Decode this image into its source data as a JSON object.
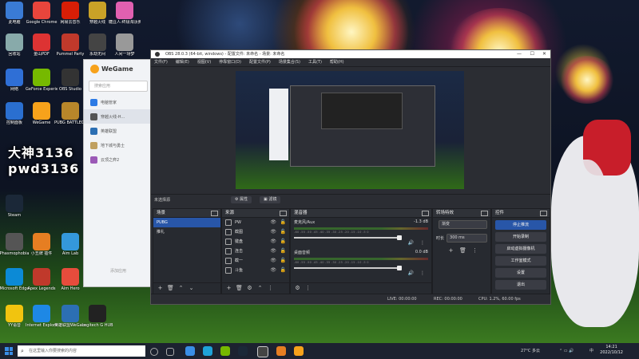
{
  "desktop": {
    "icons": [
      {
        "label": "此电脑",
        "color": "#3a7bd5"
      },
      {
        "label": "Google Chrome",
        "color": "#e8453c"
      },
      {
        "label": "网易云音乐",
        "color": "#d81e06"
      },
      {
        "label": "穿越火线",
        "color": "#c9a227"
      },
      {
        "label": "糖豆人:终极淘汰赛",
        "color": "#e060b0"
      },
      {
        "label": "回收站",
        "color": "#8aa"
      },
      {
        "label": "金山PDF",
        "color": "#d33"
      },
      {
        "label": "Pummel Party",
        "color": "#c0392b"
      },
      {
        "label": "永劫无间",
        "color": "#444"
      },
      {
        "label": "人间一场梦",
        "color": "#999"
      },
      {
        "label": "网络",
        "color": "#2f6fd6"
      },
      {
        "label": "GeForce Experience",
        "color": "#76b900"
      },
      {
        "label": "OBS Studio",
        "color": "#333"
      },
      {
        "label": "控制面板",
        "color": "#2a6fd0"
      },
      {
        "label": "WeGame",
        "color": "#f7a21b"
      },
      {
        "label": "PUBG BATTLEGR...",
        "color": "#b8862a"
      },
      {
        "label": "Steam",
        "color": "#1b2838"
      },
      {
        "label": "Phasmophobia",
        "color": "#555"
      },
      {
        "label": "小丑牌 插件",
        "color": "#e67e22"
      },
      {
        "label": "Aim Lab",
        "color": "#3498db"
      },
      {
        "label": "Microsoft Edge",
        "color": "#0c8ad6"
      },
      {
        "label": "Apex Legends",
        "color": "#c0392b"
      },
      {
        "label": "Aim Hero",
        "color": "#e74c3c"
      },
      {
        "label": "YY语音",
        "color": "#f1c40f"
      },
      {
        "label": "Internet Explorer",
        "color": "#1e88e5"
      },
      {
        "label": "英雄联盟WeGame版",
        "color": "#2c6fb3"
      },
      {
        "label": "Logitech G HUB",
        "color": "#222"
      }
    ],
    "overlay_line1": "大神3136",
    "overlay_line2": "pwd3136"
  },
  "wegame": {
    "brand": "WeGame",
    "search_placeholder": "搜索应用",
    "items": [
      {
        "label": "电脑管家",
        "color": "#2d7be5",
        "active": false
      },
      {
        "label": "穿越火线-H...",
        "color": "#555",
        "active": true
      },
      {
        "label": "英雄联盟",
        "color": "#2c6fb3",
        "active": false
      },
      {
        "label": "地下城与勇士",
        "color": "#c0a060",
        "active": false
      },
      {
        "label": "云顶之弈2",
        "color": "#9b59b6",
        "active": false
      }
    ],
    "footer": "添加应用"
  },
  "obs": {
    "title": "OBS 28.0.3 (64-bit, windows) - 配置文件: 未命名 - 场景: 未命名",
    "window_controls": [
      "—",
      "☐",
      "✕"
    ],
    "menu": [
      "文件(F)",
      "编辑(E)",
      "视图(V)",
      "停靠窗口(D)",
      "配置文件(P)",
      "场景集合(S)",
      "工具(T)",
      "帮助(H)"
    ],
    "scene_bar": {
      "name": "未选择源",
      "props": "属性",
      "filters": "滤镜"
    },
    "scenes": {
      "title": "场景",
      "items": [
        "PUBG",
        "推礼"
      ],
      "selected": 0
    },
    "sources": {
      "title": "来源",
      "items": [
        "PW",
        "截图",
        "键盘",
        "连击",
        "截一",
        "斗鱼"
      ]
    },
    "mixer": {
      "title": "混音器",
      "channels": [
        {
          "name": "麦克风/Aux",
          "db": "-1.3 dB"
        },
        {
          "name": "桌面音频",
          "db": "0.0 dB"
        }
      ],
      "ticks": "-60 -55 -50 -45 -40 -35 -30 -25 -20 -15 -10 -5 0"
    },
    "transitions": {
      "title": "转场特效",
      "type": "渐变",
      "duration_label": "时长",
      "duration": "300 ms"
    },
    "controls": {
      "title": "控件",
      "buttons": [
        "停止推流",
        "开始录制",
        "启动虚拟摄像机",
        "工作室模式",
        "设置",
        "退出"
      ]
    },
    "status": {
      "live": "LIVE: 00:00:00",
      "rec": "REC: 00:00:00",
      "cpu": "CPU: 1.2%, 60.00 fps"
    }
  },
  "taskbar": {
    "search_placeholder": "在这里输入你要搜索的内容",
    "weather": "27°C 多云",
    "time": "14:21",
    "date": "2022/10/12",
    "ime": "中"
  }
}
